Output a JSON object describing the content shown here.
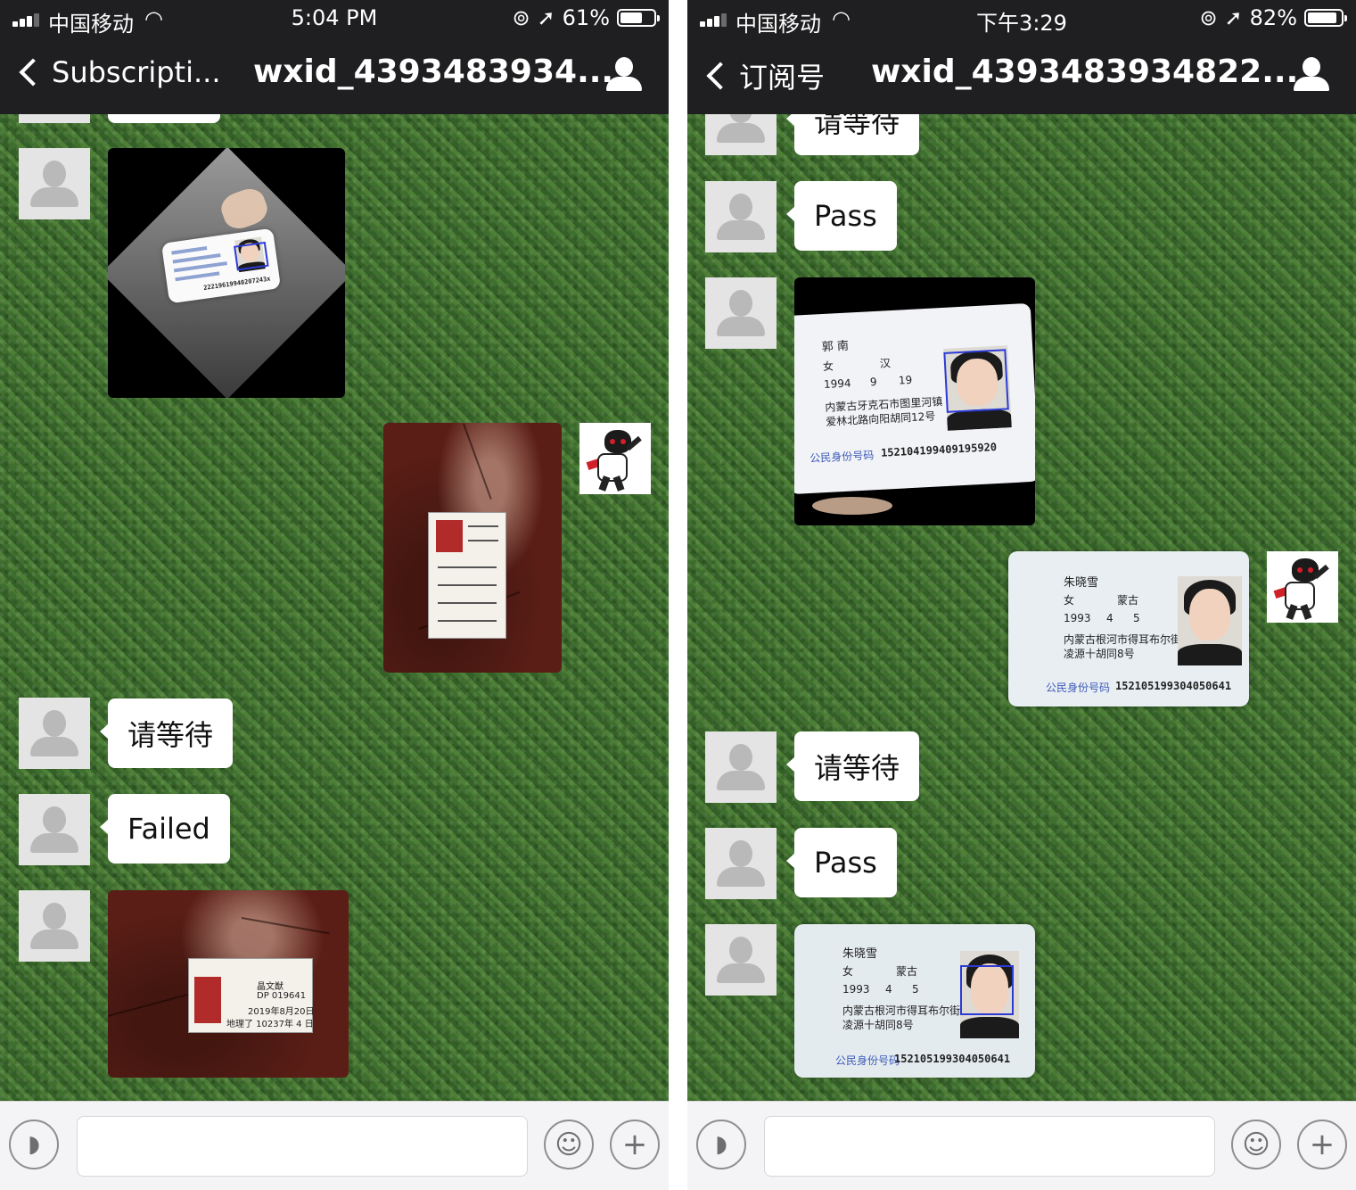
{
  "left": {
    "status": {
      "carrier": "中国移动",
      "time": "5:04 PM",
      "battery": "61%",
      "battery_level": 0.61
    },
    "nav": {
      "back_label": "Subscripti...",
      "title": "wxid_4393483934..."
    },
    "messages": {
      "wait": "请等待",
      "result": "Failed"
    },
    "id_card": {
      "number": "22219619940207243x"
    },
    "paper_card": {
      "field1": "晶文猷",
      "field2": "DP 019641",
      "field3": "2019年8月20日",
      "field4": "地理了 10237年 4 日"
    }
  },
  "right": {
    "status": {
      "carrier": "中国移动",
      "time": "下午3:29",
      "battery": "82%",
      "battery_level": 0.82
    },
    "nav": {
      "back_label": "订阅号",
      "title": "wxid_4393483934822..."
    },
    "messages": {
      "partial_top": "请等待",
      "pass1": "Pass",
      "wait": "请等待",
      "pass2": "Pass"
    },
    "card1": {
      "name": "郭 南",
      "sex": "女",
      "ethnicity": "汉",
      "birth_year": "1994",
      "birth_month": "9",
      "birth_day": "19",
      "address1": "内蒙古牙克石市图里河镇",
      "address2": "爱林北路向阳胡同12号",
      "id_label": "公民身份号码",
      "id_number": "152104199409195920"
    },
    "card2": {
      "name": "朱晓雪",
      "sex": "女",
      "ethnicity": "蒙古",
      "birth_year": "1993",
      "birth_month": "4",
      "birth_day": "5",
      "address1": "内蒙古根河市得耳布尔街",
      "address2": "凌源十胡同8号",
      "id_label": "公民身份号码",
      "id_number": "152105199304050641"
    }
  },
  "icons": {
    "back": "chevron-left-icon",
    "profile": "person-icon",
    "voice": "voice-icon",
    "emoji": "emoji-icon",
    "plus": "plus-icon",
    "signal": "signal-icon",
    "wifi": "wifi-icon",
    "location": "location-arrow-icon",
    "rotation_lock": "rotation-lock-icon"
  },
  "colors": {
    "header_bg": "#1f1f21",
    "chat_bg": "#3f6f2e",
    "bubble": "#ffffff",
    "input_bar": "#f4f4f6"
  }
}
